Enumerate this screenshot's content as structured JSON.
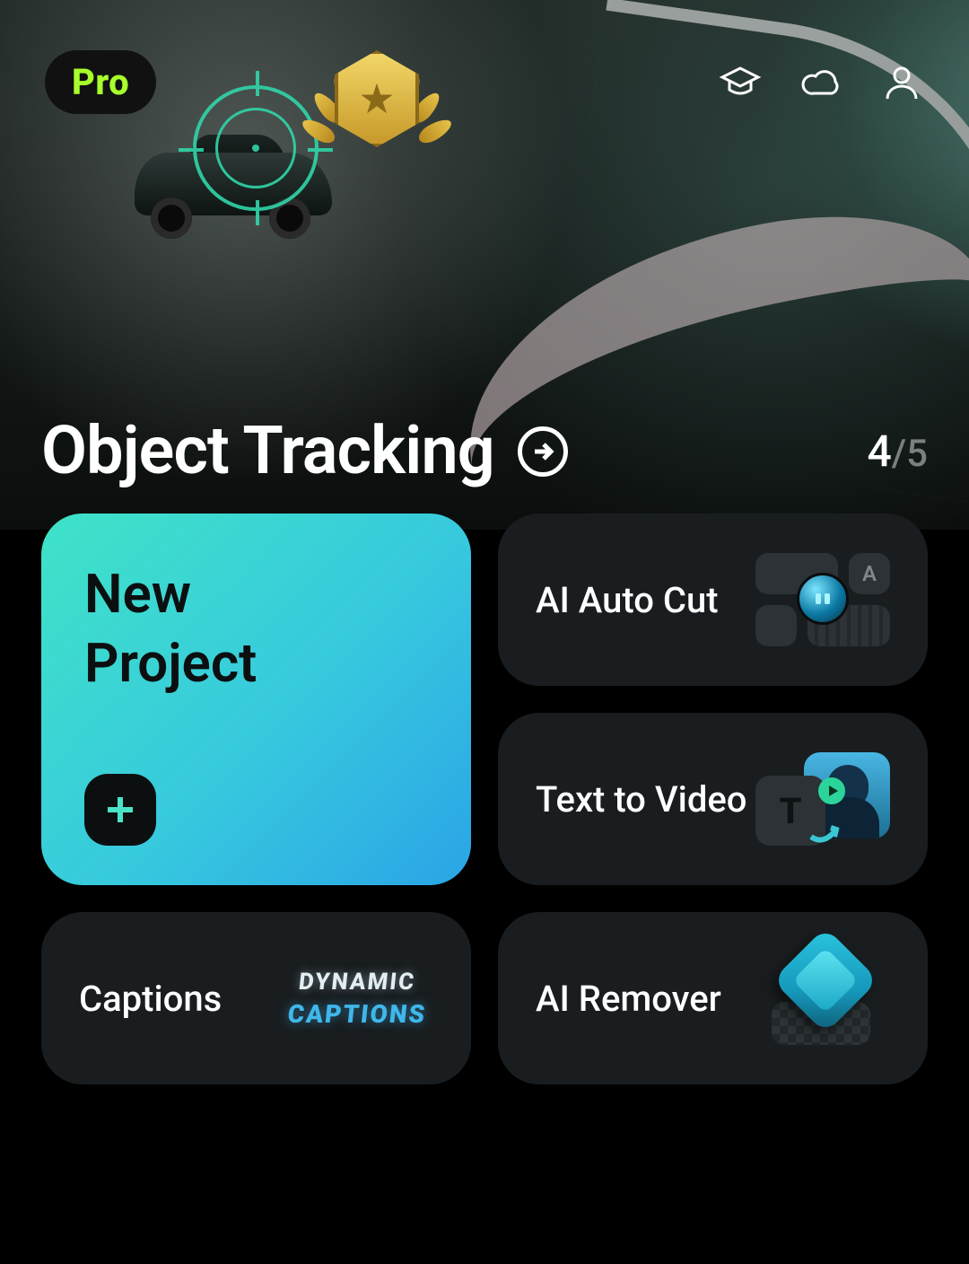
{
  "header": {
    "pro_badge": "Pro"
  },
  "hero": {
    "title": "Object Tracking",
    "page_current": "4",
    "page_sep": "/",
    "page_total": "5"
  },
  "tiles": {
    "new_project": "New\nProject",
    "ai_auto_cut": "AI Auto Cut",
    "text_to_video": "Text to Video",
    "captions": "Captions",
    "ai_remover": "AI Remover"
  },
  "captions_art": {
    "line1": "DYNAMIC",
    "line2": "CAPTIONS"
  },
  "autocut_art_letter": "A",
  "ttv_art_letter": "T"
}
